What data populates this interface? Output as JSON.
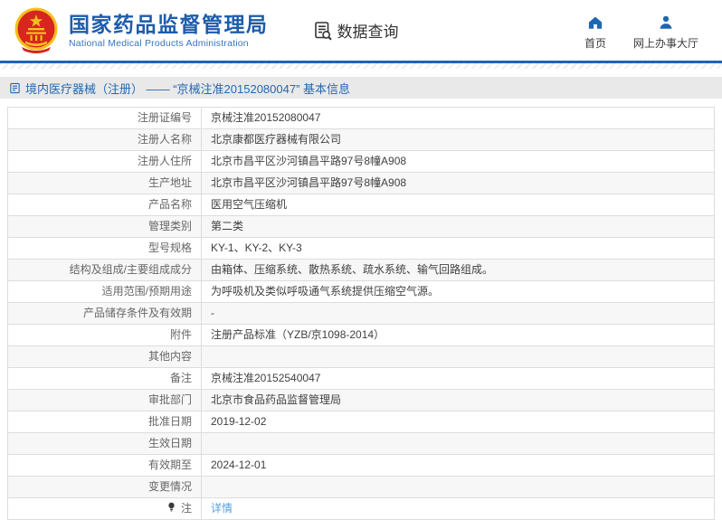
{
  "colors": {
    "accent_blue": "#1a64b8",
    "org_blue": "#1e5cab",
    "nav_icon_blue": "#1f66b1",
    "title_text_blue": "#2268b2",
    "titlebar_bg": "#e9e9e9",
    "row_alt_bg": "#f7f7f7",
    "link_blue": "#55a0e0",
    "emblem_red": "#d7261e",
    "emblem_gold": "#f5c01e"
  },
  "header": {
    "org_name_cn": "国家药品监督管理局",
    "org_name_en": "National Medical Products Administration",
    "query_label": "数据查询",
    "nav": [
      {
        "label": "首页",
        "icon": "home-icon"
      },
      {
        "label": "网上办事大厅",
        "icon": "person-icon"
      }
    ]
  },
  "titlebar": {
    "title": "境内医疗器械（注册） —— “京械注准20152080047” 基本信息"
  },
  "table": {
    "rows": [
      {
        "label": "注册证编号",
        "value": "京械注准20152080047"
      },
      {
        "label": "注册人名称",
        "value": "北京康都医疗器械有限公司"
      },
      {
        "label": "注册人住所",
        "value": "北京市昌平区沙河镇昌平路97号8幢A908"
      },
      {
        "label": "生产地址",
        "value": "北京市昌平区沙河镇昌平路97号8幢A908"
      },
      {
        "label": "产品名称",
        "value": "医用空气压缩机"
      },
      {
        "label": "管理类别",
        "value": "第二类"
      },
      {
        "label": "型号规格",
        "value": "KY-1、KY-2、KY-3"
      },
      {
        "label": "结构及组成/主要组成成分",
        "value": "由箱体、压缩系统、散热系统、疏水系统、输气回路组成。"
      },
      {
        "label": "适用范围/预期用途",
        "value": "为呼吸机及类似呼吸通气系统提供压缩空气源。"
      },
      {
        "label": "产品储存条件及有效期",
        "value": "-"
      },
      {
        "label": "附件",
        "value": "注册产品标准（YZB/京1098-2014）"
      },
      {
        "label": "其他内容",
        "value": ""
      },
      {
        "label": "备注",
        "value": "京械注准20152540047"
      },
      {
        "label": "审批部门",
        "value": "北京市食品药品监督管理局"
      },
      {
        "label": "批准日期",
        "value": "2019-12-02"
      },
      {
        "label": "生效日期",
        "value": ""
      },
      {
        "label": "有效期至",
        "value": "2024-12-01"
      },
      {
        "label": "变更情况",
        "value": ""
      },
      {
        "label": "注",
        "value": "详情",
        "value_is_link": true,
        "label_icon": "bulb-icon"
      }
    ]
  }
}
